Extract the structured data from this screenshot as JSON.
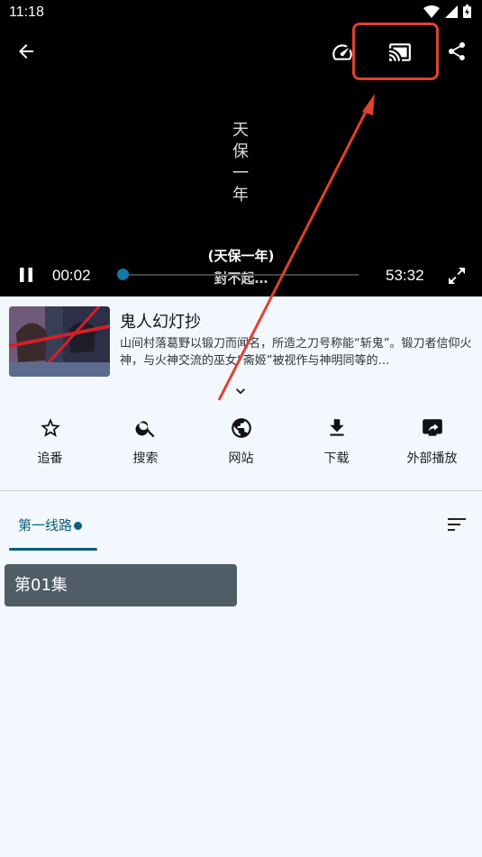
{
  "status": {
    "time": "11:18"
  },
  "player": {
    "vertical_text": [
      "天",
      "保",
      "一",
      "年"
    ],
    "subtitle_line1": "(天保一年)",
    "subtitle_line2": "對不起…",
    "current_time": "00:02",
    "duration": "53:32",
    "progress": 0.001
  },
  "anime": {
    "title": "鬼人幻灯抄",
    "description": "山间村落葛野以锻刀而闻名，所造之刀号称能“斩鬼”。锻刀者信仰火神，与火神交流的巫女“斋姬”被视作与神明同等的…"
  },
  "actions": [
    {
      "label": "追番",
      "icon": "star-outline-icon"
    },
    {
      "label": "搜索",
      "icon": "search-icon"
    },
    {
      "label": "网站",
      "icon": "globe-icon"
    },
    {
      "label": "下载",
      "icon": "download-icon"
    },
    {
      "label": "外部播放",
      "icon": "external-play-icon"
    }
  ],
  "tabs": [
    {
      "label": "第一线路"
    }
  ],
  "episodes": [
    {
      "label": "第01集"
    }
  ],
  "colors": {
    "accent": "#0d5d80",
    "highlight": "#e0412f",
    "episode_bg": "#4f5d67",
    "background": "#f2f8fd"
  }
}
